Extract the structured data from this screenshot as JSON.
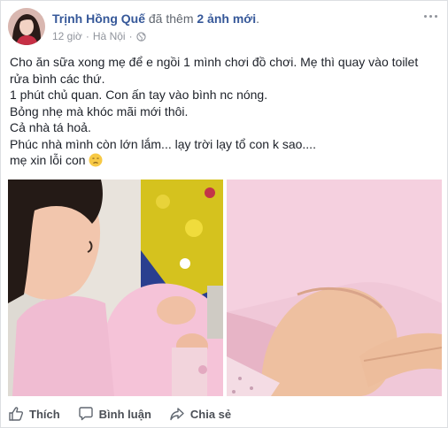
{
  "post": {
    "author": "Trịnh Hồng Quế",
    "activity_prefix": "đã thêm",
    "activity_highlight": "2 ảnh mới",
    "activity_suffix": ".",
    "time": "12 giờ",
    "separator": "·",
    "location": "Hà Nội",
    "separator2": "·",
    "privacy_icon": "globe-icon",
    "more_icon": "more-options-icon",
    "lines": [
      "Cho ăn sữa xong mẹ để e ngồi 1 mình chơi đồ chơi. Mẹ thì quay vào toilet rửa bình các thứ.",
      "1 phút chủ quan. Con ấn tay vào bình nc nóng.",
      "Bỏng nhẹ mà khóc mãi mới thôi.",
      "Cả nhà tá hoả.",
      "Phúc nhà mình còn lớn lắm... lạy trời lạy tổ con k sao....",
      "mẹ xin lỗi con"
    ],
    "emoji": "sad-face-emoji"
  },
  "actions": {
    "like": "Thích",
    "comment": "Bình luận",
    "share": "Chia sẻ"
  },
  "colors": {
    "link": "#365899",
    "meta": "#90949c",
    "text": "#1d2129",
    "action": "#4b4f56"
  }
}
